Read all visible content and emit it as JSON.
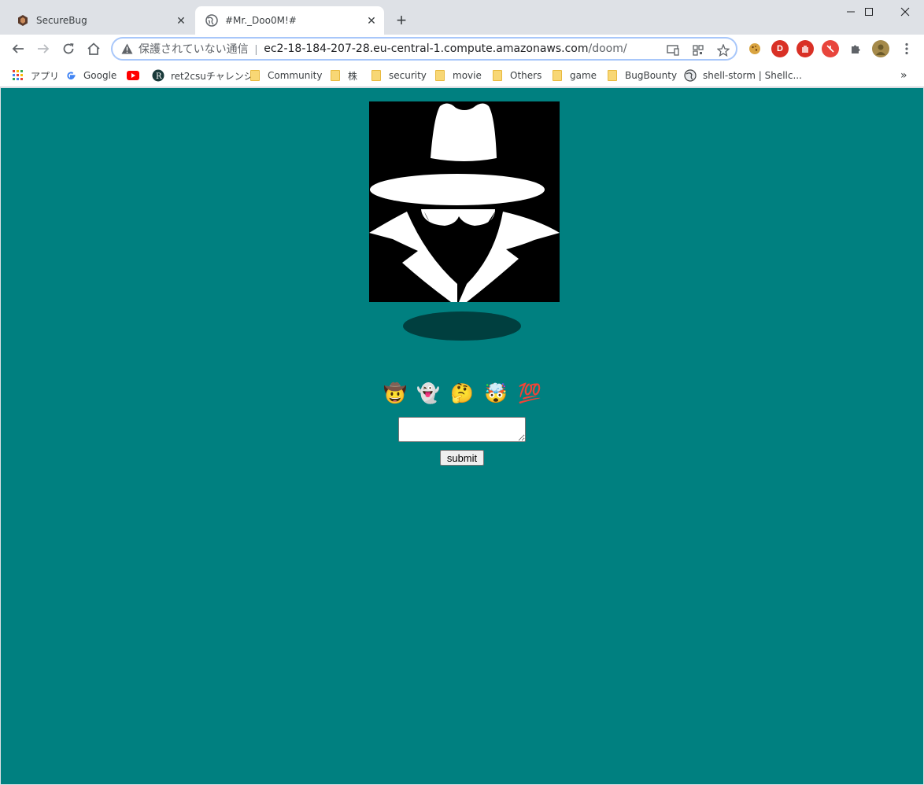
{
  "browser": {
    "tabs": [
      {
        "title": "SecureBug",
        "active": false
      },
      {
        "title": "#Mr._Doo0M!#",
        "active": true
      }
    ],
    "address_bar": {
      "security_text": "保護されていない通信",
      "separator": "|",
      "host": "ec2-18-184-207-28.eu-central-1.compute.amazonaws.com",
      "path": "/doom/"
    },
    "extensions": [
      {
        "name": "cookie-extension-icon",
        "label": ""
      },
      {
        "name": "d-extension-icon",
        "label": "D",
        "color": "#d93025"
      },
      {
        "name": "stop-extension-icon",
        "label": "",
        "color": "#d93025"
      },
      {
        "name": "red-extension-icon",
        "label": "",
        "color": "#e8453c"
      },
      {
        "name": "puzzle-extension-icon",
        "label": ""
      }
    ],
    "bookmarks": [
      {
        "label": "アプリ",
        "icon": "apps-grid-icon"
      },
      {
        "label": "Google",
        "icon": "google-icon"
      },
      {
        "label": "",
        "icon": "youtube-icon"
      },
      {
        "label": "ret2csuチャレンジ",
        "icon": "ret2csu-icon"
      },
      {
        "label": "Community",
        "icon": "folder-icon"
      },
      {
        "label": "株",
        "icon": "folder-icon"
      },
      {
        "label": "security",
        "icon": "folder-icon"
      },
      {
        "label": "movie",
        "icon": "folder-icon"
      },
      {
        "label": "Others",
        "icon": "folder-icon"
      },
      {
        "label": "game",
        "icon": "folder-icon"
      },
      {
        "label": "BugBounty",
        "icon": "folder-icon"
      },
      {
        "label": "shell-storm | Shellc...",
        "icon": "globe-icon"
      }
    ],
    "overflow": "»"
  },
  "page": {
    "background": "#008080",
    "image": "spy-hat-icon",
    "emojis": [
      "🤠",
      "👻",
      "🤔",
      "🤯",
      "💯"
    ],
    "textarea_value": "",
    "submit_label": "submit"
  }
}
